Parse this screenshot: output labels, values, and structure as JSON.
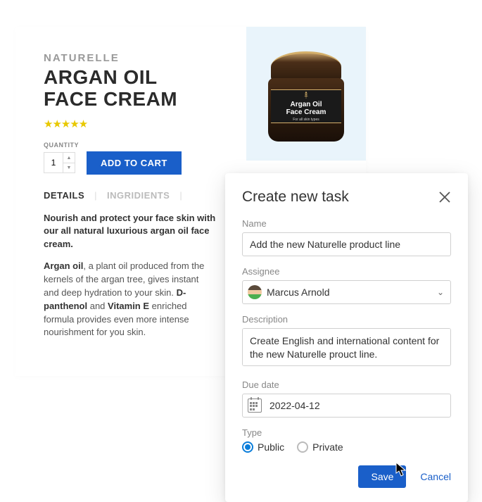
{
  "product": {
    "brand": "NATURELLE",
    "name_line1": "ARGAN OIL",
    "name_line2": "FACE CREAM",
    "qty_label": "QUANTITY",
    "qty_value": "1",
    "add_to_cart": "ADD TO CART",
    "tabs": {
      "details": "DETAILS",
      "ingredients": "INGRIDIENTS"
    },
    "desc_lead": "Nourish and protect your face skin with our all natural luxurious argan oil face cream.",
    "desc_body_pre": "Argan oil",
    "desc_body_1": ", a plant oil produced from the kernels of the argan tree, gives instant and deep hydration to your skin. ",
    "desc_body_b2": "D-panthenol",
    "desc_body_and": " and ",
    "desc_body_b3": "Vitamin E",
    "desc_body_2": " enriched formula provides even more intense nourishment for you skin.",
    "image_label1": "Argan Oil",
    "image_label2": "Face Cream",
    "image_label3": "For all skin types"
  },
  "modal": {
    "title": "Create new task",
    "name_label": "Name",
    "name_value": "Add the new Naturelle product line",
    "assignee_label": "Assignee",
    "assignee_value": "Marcus Arnold",
    "desc_label": "Description",
    "desc_value": "Create English and international content for the new Naturelle prouct line.",
    "due_label": "Due date",
    "due_value": "2022-04-12",
    "type_label": "Type",
    "type_public": "Public",
    "type_private": "Private",
    "save": "Save",
    "cancel": "Cancel"
  }
}
